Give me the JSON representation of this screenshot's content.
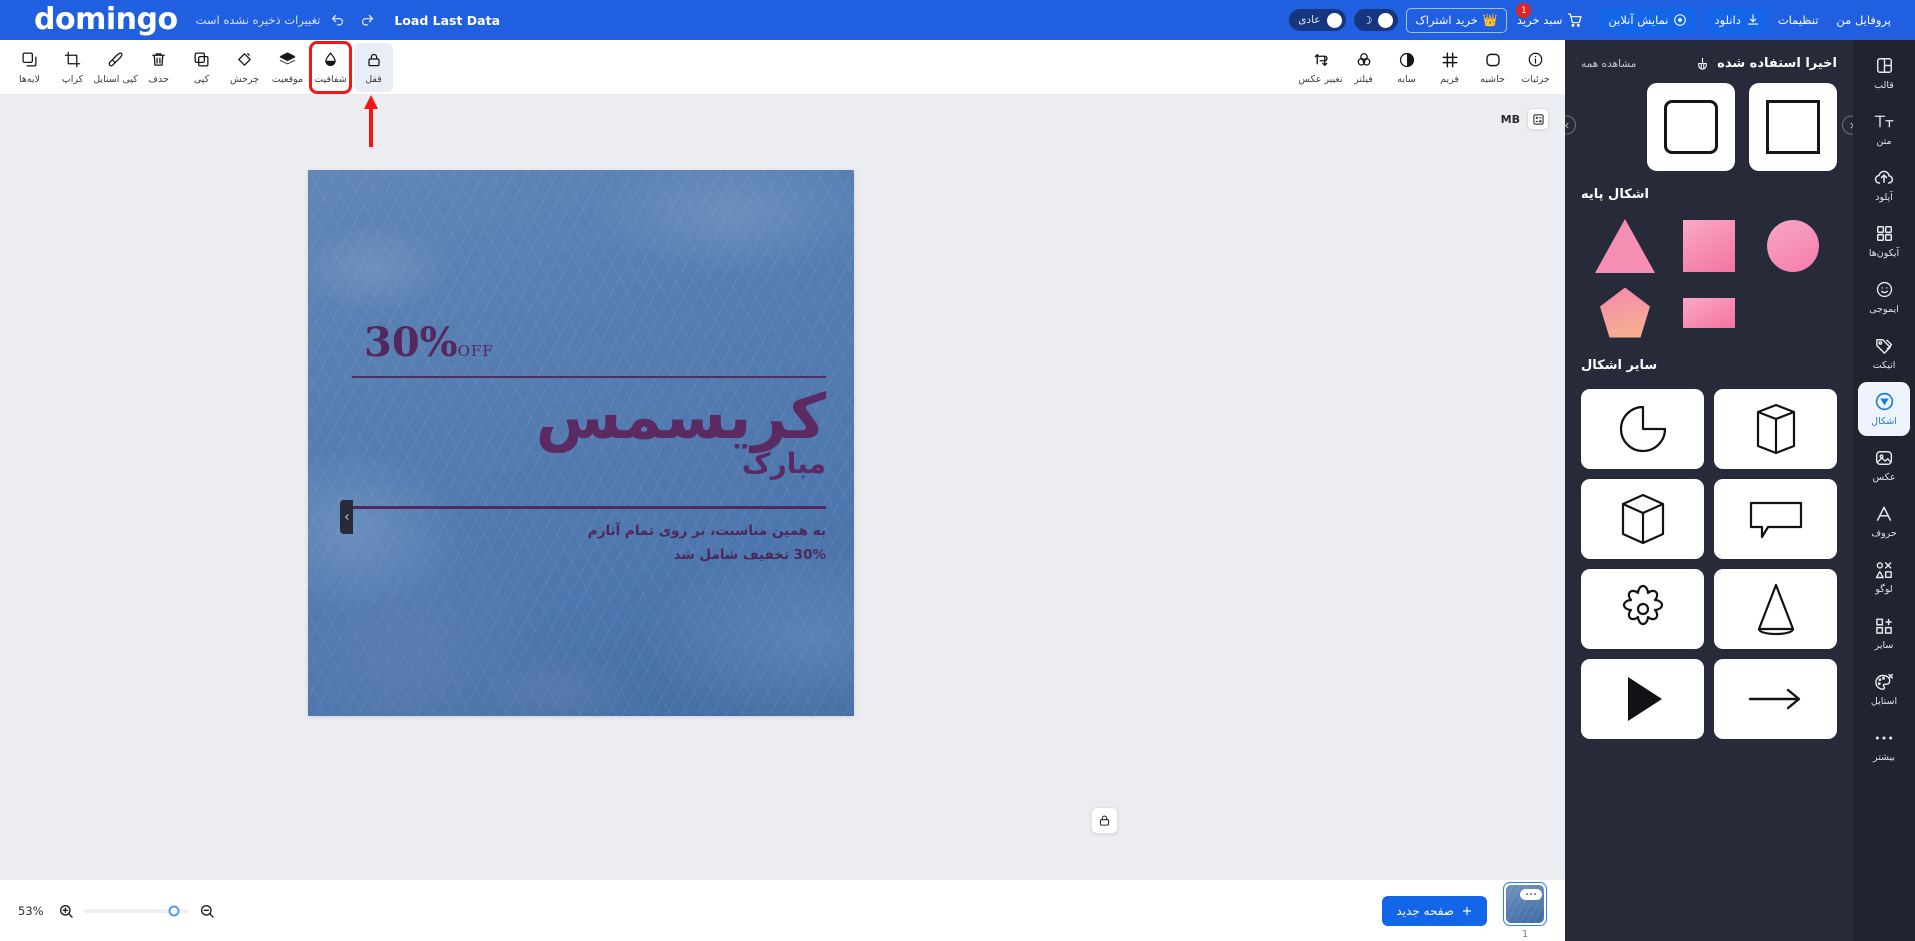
{
  "header": {
    "logo": "domingo",
    "unsaved_text": "تغییرات ذخیره نشده است",
    "undo_icon": "undo-icon",
    "redo_icon": "redo-icon",
    "load_last_data": "Load Last Data",
    "mode_toggle_label": "عادی",
    "theme_toggle_icon": "moon-icon",
    "subscribe_label": "خرید اشتراک",
    "subscribe_icon": "crown-icon",
    "cart_label": "سبد خرید",
    "cart_badge": "1",
    "preview_label": "نمایش آنلاین",
    "download_label": "دانلود",
    "settings_label": "تنظیمات",
    "profile_label": "پروفایل من"
  },
  "toolbar": {
    "left_tools": [
      {
        "label": "لایه‌ها",
        "icon": "layers-icon"
      },
      {
        "label": "کراپ",
        "icon": "crop-icon"
      },
      {
        "label": "کپی استایل",
        "icon": "brush-icon"
      },
      {
        "label": "حذف",
        "icon": "trash-icon"
      },
      {
        "label": "کپی",
        "icon": "copy-icon"
      },
      {
        "label": "چرخش",
        "icon": "rotate-icon"
      },
      {
        "label": "موقعیت",
        "icon": "position-icon"
      },
      {
        "label": "شفافیت",
        "icon": "opacity-icon"
      },
      {
        "label": "قفل",
        "icon": "lock-icon"
      }
    ],
    "right_tools": [
      {
        "label": "جزئیات",
        "icon": "info-icon"
      },
      {
        "label": "حاشیه",
        "icon": "border-icon"
      },
      {
        "label": "فریم",
        "icon": "frame-icon"
      },
      {
        "label": "سایه",
        "icon": "shadow-icon"
      },
      {
        "label": "فیلتر",
        "icon": "filter-icon"
      },
      {
        "label": "تغییر عکس",
        "icon": "swap-image-icon"
      }
    ],
    "highlighted_tool": "شفافیت",
    "active_tool": "قفل"
  },
  "canvas": {
    "size_chip_label": "MB",
    "size_chip_icon": "calculator-icon",
    "lock_float_icon": "lock-icon",
    "collapse_icon": "chevron-down-icon",
    "design": {
      "discount_number": "30%",
      "discount_suffix": "OFF",
      "title": "کریسمس",
      "subtitle": "مبارک",
      "description_line1": "به همین مناسبت، بر روی تمام آثارم",
      "description_line2": "30% تخفیف شامل شد"
    }
  },
  "bottom": {
    "zoom_percent": "53%",
    "zoom_in_icon": "zoom-in-icon",
    "zoom_out_icon": "zoom-out-icon",
    "new_page_label": "صفحه جدید",
    "new_page_icon": "plus-icon",
    "page_number": "1",
    "thumb_menu_icon": "ellipsis-icon"
  },
  "shapes_panel": {
    "recent_title": "اخیرا استفاده شده",
    "recent_icon": "broom-icon",
    "see_all": "مشاهده همه",
    "recent_items": [
      "rounded-square-outline",
      "square-outline"
    ],
    "nav_prev_icon": "chevron-left-icon",
    "nav_next_icon": "chevron-right-icon",
    "basic_title": "اشکال پایه",
    "basic_shapes": [
      "circle",
      "square",
      "triangle",
      "",
      "rectangle",
      "pentagon"
    ],
    "other_title": "سایر اشکال",
    "other_shapes": [
      "pie-slice",
      "hexagonal-prism",
      "cube",
      "speech-bubble",
      "flower",
      "cone",
      "play-triangle",
      "arrow-right"
    ],
    "collapse_icon": "chevron-left-icon"
  },
  "right_rail": {
    "items": [
      {
        "label": "قالب",
        "icon": "template-icon",
        "active": false
      },
      {
        "label": "متن",
        "icon": "text-icon",
        "active": false
      },
      {
        "label": "آپلود",
        "icon": "upload-icon",
        "active": false
      },
      {
        "label": "آیکون‌ها",
        "icon": "grid-icons-icon",
        "active": false
      },
      {
        "label": "ایموجی",
        "icon": "emoji-icon",
        "active": false
      },
      {
        "label": "اتیکت",
        "icon": "tag-icon",
        "active": false
      },
      {
        "label": "اشکال",
        "icon": "shapes-icon",
        "active": true
      },
      {
        "label": "عکس",
        "icon": "image-icon",
        "active": false
      },
      {
        "label": "حروف",
        "icon": "letter-a-icon",
        "active": false
      },
      {
        "label": "لوگو",
        "icon": "logo-icon",
        "active": false
      },
      {
        "label": "سایر",
        "icon": "other-plus-icon",
        "active": false
      },
      {
        "label": "استایل",
        "icon": "palette-icon",
        "active": false
      },
      {
        "label": "بیشتر",
        "icon": "ellipsis-icon",
        "active": false
      }
    ]
  }
}
